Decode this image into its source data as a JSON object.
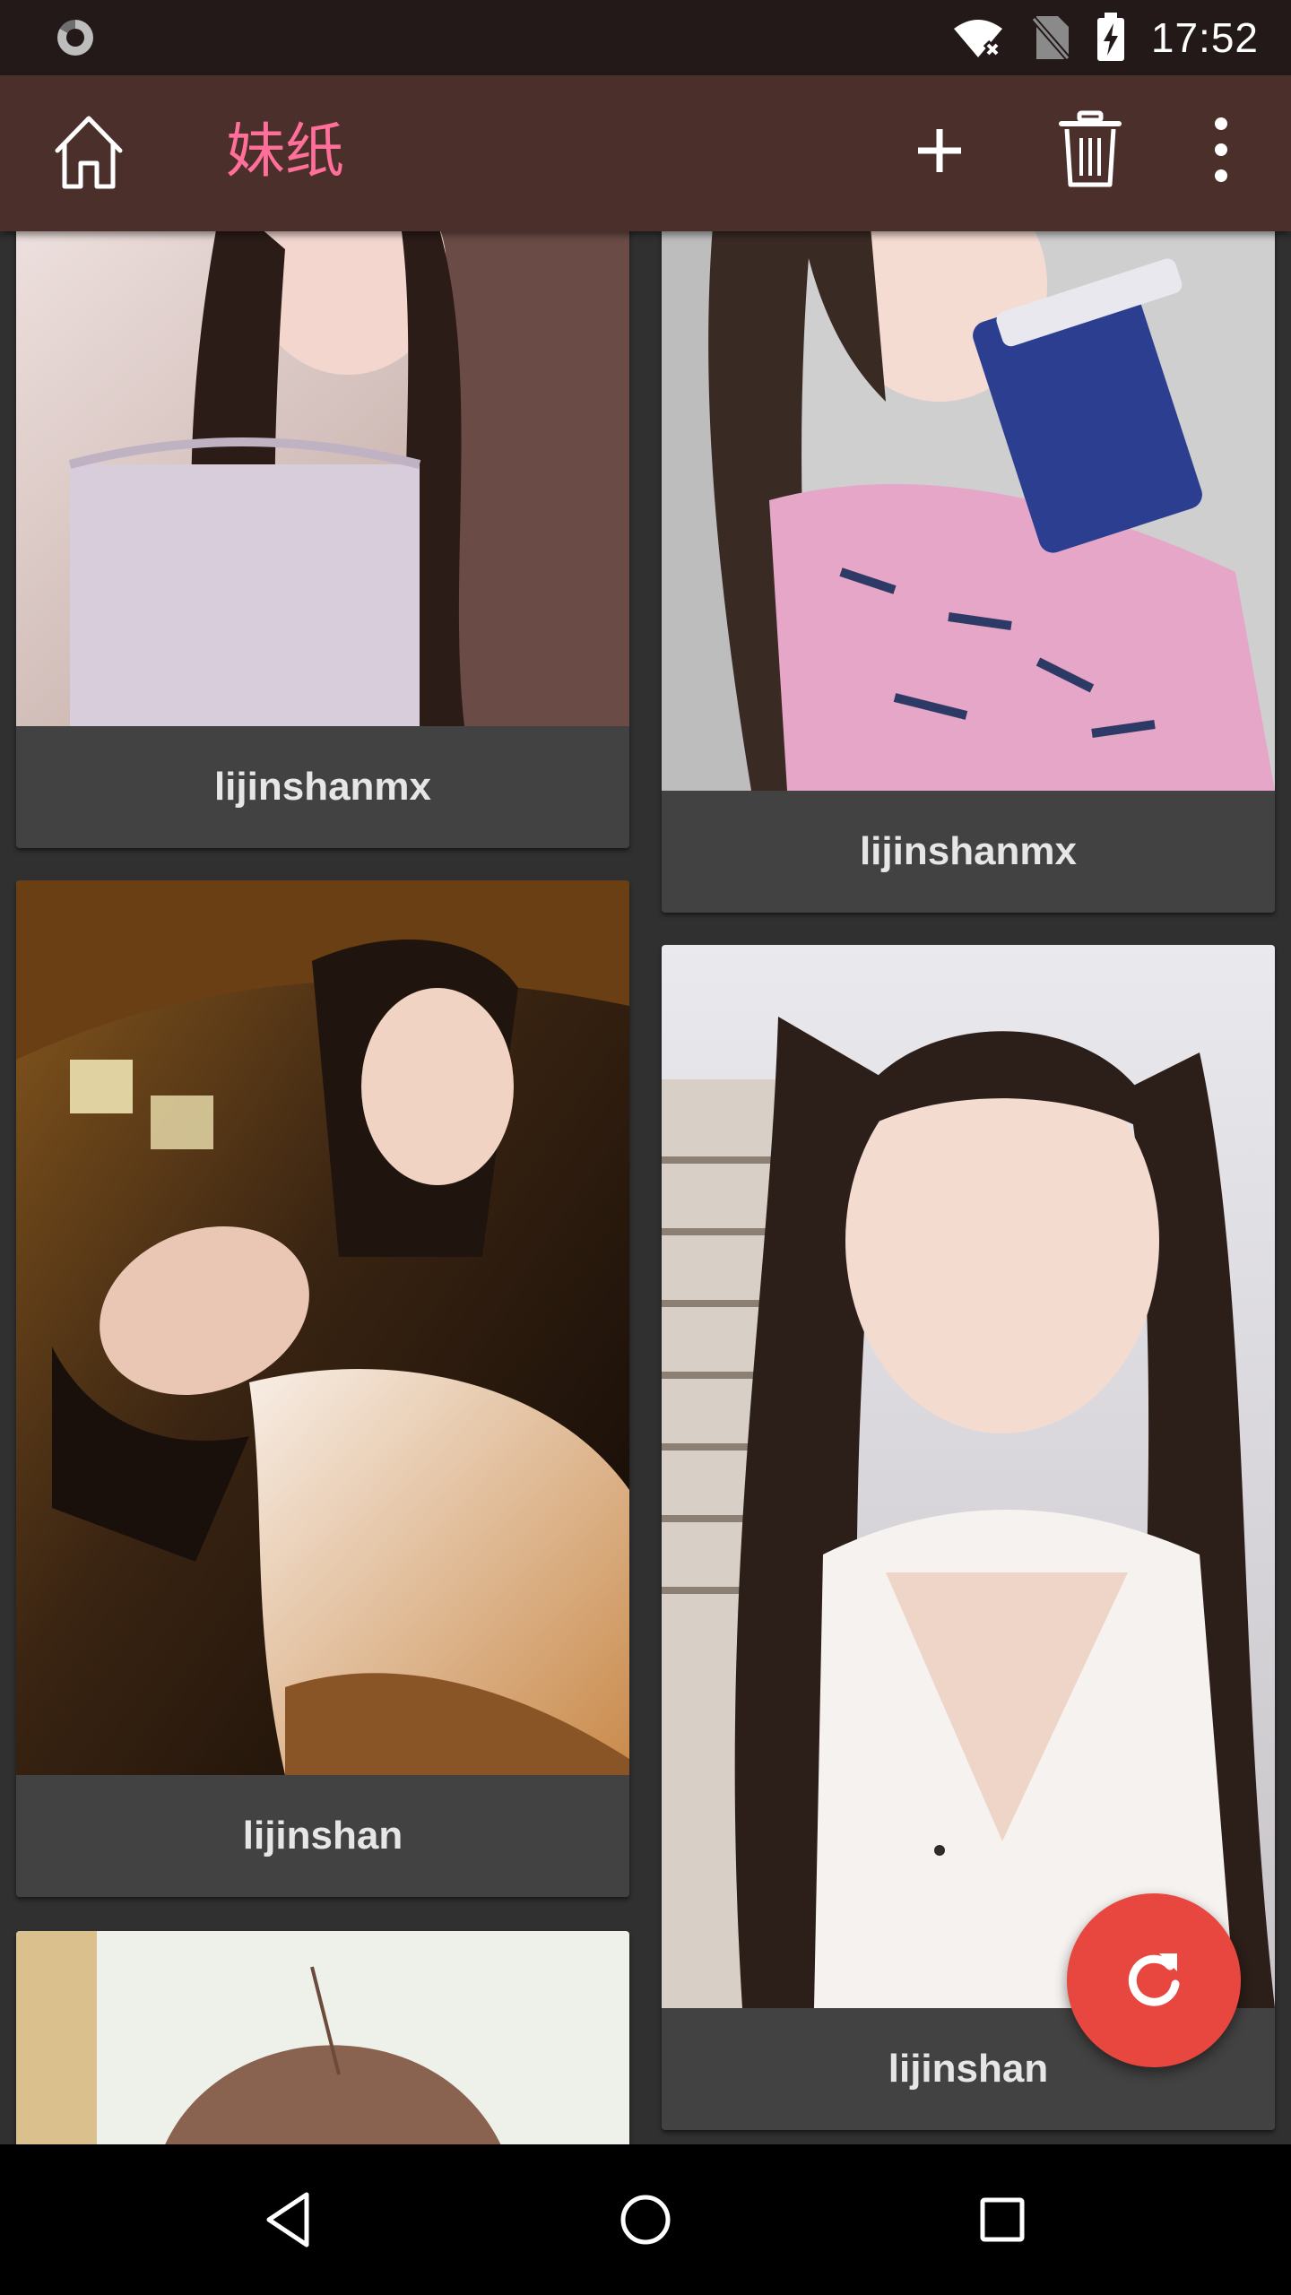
{
  "status_bar": {
    "time": "17:52",
    "icons": [
      "spinner-icon",
      "wifi-off-icon",
      "no-sim-icon",
      "battery-charging-icon"
    ]
  },
  "app_bar": {
    "title": "妹纸",
    "icons": [
      "home-icon",
      "add-icon",
      "delete-icon",
      "more-vert-icon"
    ],
    "title_color": "#ff6f9a",
    "background": "#4b2f2b"
  },
  "cards": [
    {
      "name": "lijinshanmx"
    },
    {
      "name": "lijinshanmx"
    },
    {
      "name": "lijinshan"
    },
    {
      "name": "lijinshan"
    },
    {
      "name": ""
    }
  ],
  "fab": {
    "icon": "refresh-icon",
    "color": "#e8473f"
  },
  "nav_bar": {
    "icons": [
      "back-icon",
      "home-circle-icon",
      "recents-icon"
    ]
  }
}
